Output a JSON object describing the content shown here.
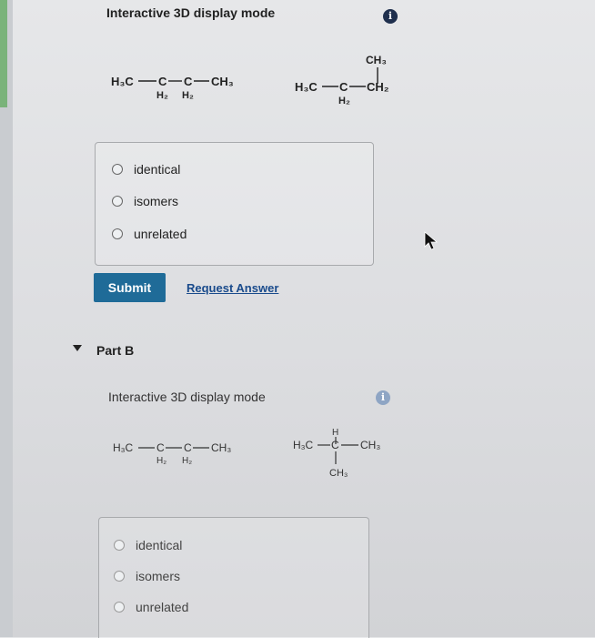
{
  "part_a": {
    "title": "Interactive 3D display mode",
    "info_icon": "info-icon",
    "options": [
      "identical",
      "isomers",
      "unrelated"
    ],
    "submit_label": "Submit",
    "request_answer_label": "Request Answer"
  },
  "part_b": {
    "collapse_icon": "triangle-down-icon",
    "header": "Part B",
    "title": "Interactive 3D display mode",
    "info_icon": "info-icon",
    "options": [
      "identical",
      "isomers",
      "unrelated"
    ]
  },
  "colors": {
    "submit_bg": "#1f6b98",
    "link": "#1a4b8c",
    "info_dark": "#1f2f4d",
    "info_light": "#8ea5c4"
  }
}
